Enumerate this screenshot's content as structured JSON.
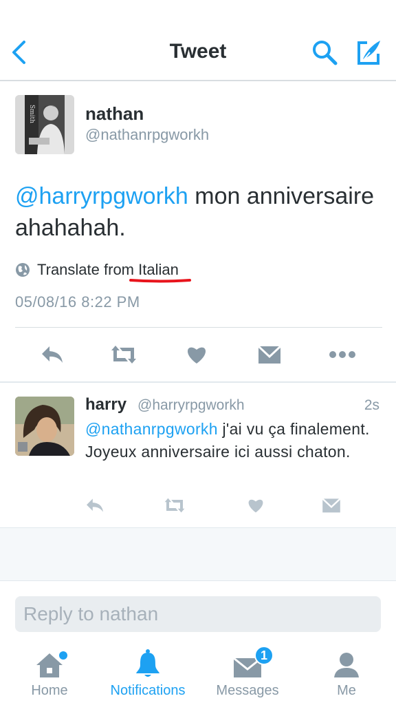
{
  "header": {
    "title": "Tweet",
    "back_icon": "chevron-left-icon",
    "search_icon": "search-icon",
    "compose_icon": "compose-icon",
    "accent_color": "#1da1f2"
  },
  "tweet": {
    "name": "nathan",
    "handle": "@nathanrpgworkh",
    "mention": "@harryrpgworkh",
    "text": " mon anniversaire ahahahah.",
    "translate": "Translate from Italian",
    "timestamp": "05/08/16 8:22 PM",
    "avatar_overlay_text": "Smith"
  },
  "tweet_actions": [
    "reply-icon",
    "retweet-icon",
    "like-icon",
    "dm-icon",
    "more-icon"
  ],
  "reply": {
    "name": "harry",
    "handle": "@harryrpgworkh",
    "time": "2s",
    "mention": "@nathanrpgworkh",
    "text": " j'ai vu ça finalement. Joyeux anniversaire ici aussi chaton."
  },
  "composer": {
    "placeholder": "Reply to nathan"
  },
  "tabs": [
    {
      "label": "Home",
      "icon": "home-icon",
      "active": false,
      "dot": true
    },
    {
      "label": "Notifications",
      "icon": "bell-icon",
      "active": true
    },
    {
      "label": "Messages",
      "icon": "envelope-icon",
      "active": false,
      "badge": "1"
    },
    {
      "label": "Me",
      "icon": "person-icon",
      "active": false
    }
  ]
}
